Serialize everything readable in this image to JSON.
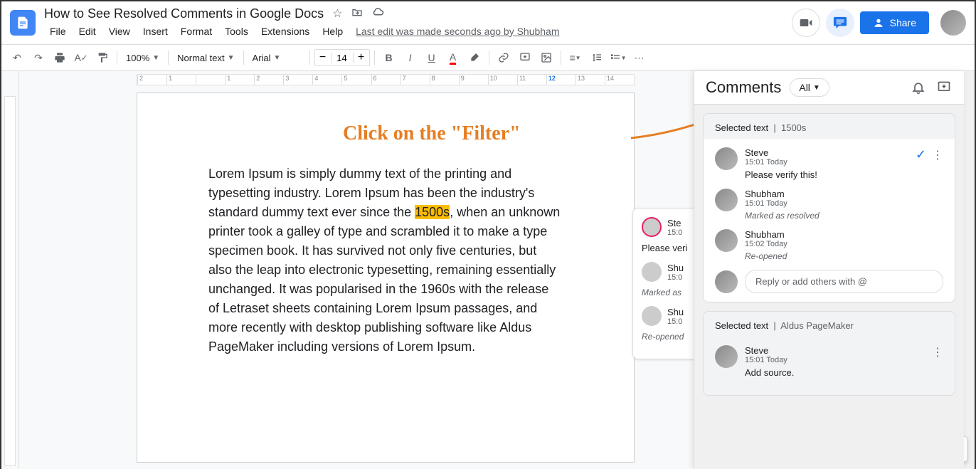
{
  "doc_title": "How to See Resolved Comments in Google Docs",
  "menus": [
    "File",
    "Edit",
    "View",
    "Insert",
    "Format",
    "Tools",
    "Extensions",
    "Help"
  ],
  "last_edit": "Last edit was made seconds ago by Shubham",
  "share_label": "Share",
  "toolbar": {
    "zoom": "100%",
    "style": "Normal text",
    "font": "Arial",
    "font_size": "14"
  },
  "ruler_marks": [
    "2",
    "1",
    "",
    "1",
    "2",
    "3",
    "4",
    "5",
    "6",
    "7",
    "8",
    "9",
    "10",
    "11",
    "12",
    "13",
    "14"
  ],
  "ruler_active_index": 14,
  "document": {
    "text_before": "Lorem Ipsum is simply dummy text of the printing and typesetting industry. Lorem Ipsum has been the industry's standard dummy text ever since the ",
    "highlighted": "1500s",
    "text_after": ", when an unknown printer took a galley of type and scrambled it to make a type specimen book. It has survived not only five centuries, but also the leap into electronic typesetting, remaining essentially unchanged. It was popularised in the 1960s with the release of Letraset sheets containing Lorem Ipsum passages, and more recently with desktop publishing software like Aldus PageMaker including versions of Lorem Ipsum."
  },
  "annotation": "Click on the \"Filter\"",
  "bg_comment": {
    "user1": "Ste",
    "time1": "15:0",
    "text1": "Please veri",
    "user2": "Shu",
    "time2": "15:0",
    "status2": "Marked as",
    "user3": "Shu",
    "time3": "15:0",
    "status3": "Re-opened"
  },
  "panel": {
    "title": "Comments",
    "filter": "All",
    "reply_placeholder": "Reply or add others with @",
    "threads": [
      {
        "selected_label": "Selected text",
        "selected_value": "1500s",
        "comments": [
          {
            "name": "Steve",
            "time": "15:01 Today",
            "text": "Please verify this!",
            "has_check": true,
            "has_more": true
          },
          {
            "name": "Shubham",
            "time": "15:01 Today",
            "status": "Marked as resolved"
          },
          {
            "name": "Shubham",
            "time": "15:02 Today",
            "status": "Re-opened"
          }
        ],
        "has_reply": true
      },
      {
        "selected_label": "Selected text",
        "selected_value": "Aldus PageMaker",
        "grey": true,
        "comments": [
          {
            "name": "Steve",
            "time": "15:01 Today",
            "text": "Add source.",
            "has_more": true
          }
        ]
      }
    ]
  }
}
